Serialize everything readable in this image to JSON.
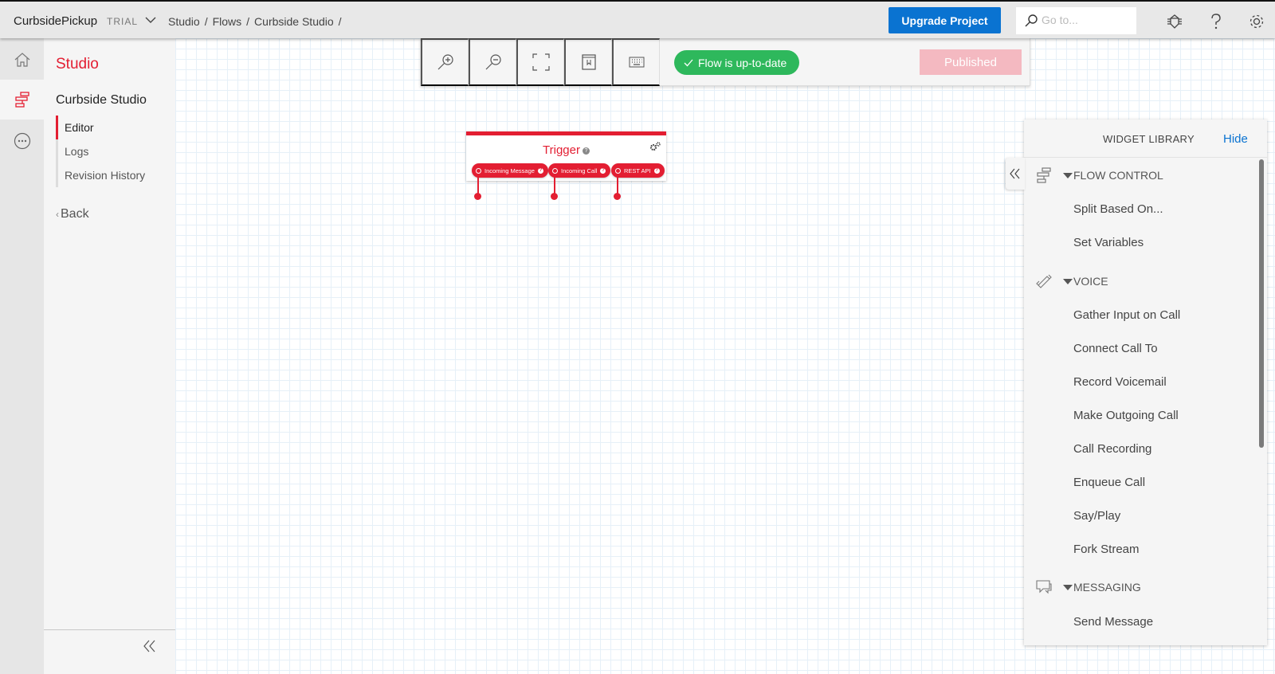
{
  "topbar": {
    "project_name": "CurbsidePickup",
    "badge": "TRIAL",
    "breadcrumb": [
      "Studio",
      "Flows",
      "Curbside Studio"
    ],
    "separator": "/",
    "upgrade_label": "Upgrade Project",
    "search_placeholder": "Go to...",
    "icons": [
      "debugger-bug-icon",
      "help-question-icon",
      "settings-gear-icon"
    ]
  },
  "rail": {
    "items": [
      {
        "name": "home",
        "icon": "home-icon",
        "active": false
      },
      {
        "name": "studio",
        "icon": "flow-studio-icon",
        "active": true
      },
      {
        "name": "more",
        "icon": "more-ellipsis-icon",
        "active": false
      }
    ]
  },
  "sidenav": {
    "section_title": "Studio",
    "flow_name": "Curbside Studio",
    "items": [
      {
        "label": "Editor",
        "active": true
      },
      {
        "label": "Logs",
        "active": false
      },
      {
        "label": "Revision History",
        "active": false
      }
    ],
    "back_label": "Back",
    "back_glyph": "‹"
  },
  "toolbar": {
    "tools": [
      "zoom-in-icon",
      "zoom-out-icon",
      "fit-to-screen-icon",
      "docs-bookmark-icon",
      "keyboard-shortcuts-icon"
    ],
    "status": "Flow is up-to-date",
    "status_color": "#2eb85c",
    "publish_label": "Published",
    "publish_color": "#f4b9c1"
  },
  "trigger": {
    "title": "Trigger",
    "help_glyph": "?",
    "ports": [
      "Incoming Message",
      "Incoming Call",
      "REST API"
    ],
    "accent": "#e31e32"
  },
  "widget_library": {
    "title": "WIDGET LIBRARY",
    "hide_label": "Hide",
    "sections": [
      {
        "label": "FLOW CONTROL",
        "icon": "flow-control-icon",
        "items": [
          "Split Based On...",
          "Set Variables"
        ]
      },
      {
        "label": "VOICE",
        "icon": "phone-icon",
        "items": [
          "Gather Input on Call",
          "Connect Call To",
          "Record Voicemail",
          "Make Outgoing Call",
          "Call Recording",
          "Enqueue Call",
          "Say/Play",
          "Fork Stream"
        ]
      },
      {
        "label": "MESSAGING",
        "icon": "chat-bubbles-icon",
        "items": [
          "Send Message"
        ]
      }
    ]
  }
}
